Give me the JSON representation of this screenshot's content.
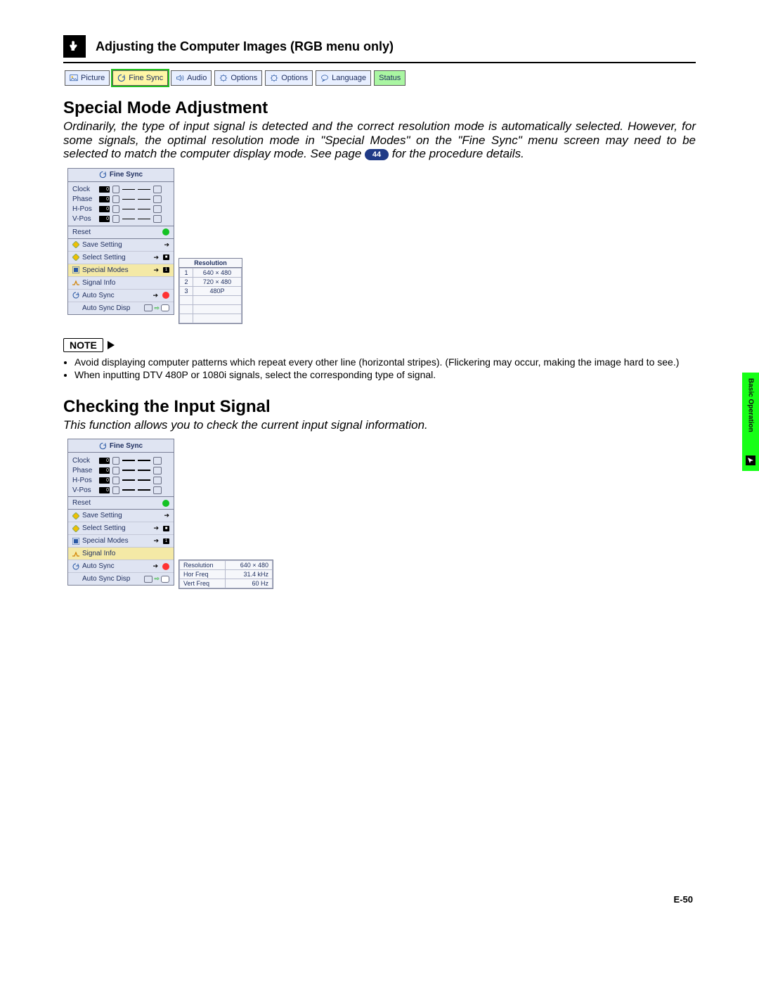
{
  "header": {
    "title": "Adjusting the Computer Images (RGB menu only)"
  },
  "tabs": [
    {
      "label": "Picture",
      "icon": "picture-icon",
      "sel": false
    },
    {
      "label": "Fine Sync",
      "icon": "sync-icon",
      "sel": true
    },
    {
      "label": "Audio",
      "icon": "audio-icon",
      "sel": false
    },
    {
      "label": "Options",
      "icon": "options-icon",
      "sel": false
    },
    {
      "label": "Options",
      "icon": "options-icon",
      "sel": false
    },
    {
      "label": "Language",
      "icon": "language-icon",
      "sel": false
    },
    {
      "label": "Status",
      "icon": "status-icon",
      "sel": false
    }
  ],
  "section1": {
    "heading": "Special Mode Adjustment",
    "para_a": "Ordinarily, the type of input signal is detected and the correct resolution mode is automatically selected. However, for some signals, the optimal resolution mode in \"Special Modes\" on the \"Fine Sync\" menu screen may need to be selected to match the computer display mode. See page ",
    "pageref": "44",
    "para_b": " for the procedure details."
  },
  "fine_sync_menu": {
    "title": "Fine Sync",
    "sliders": [
      {
        "label": "Clock",
        "value": "0"
      },
      {
        "label": "Phase",
        "value": "0"
      },
      {
        "label": "H-Pos",
        "value": "0"
      },
      {
        "label": "V-Pos",
        "value": "0"
      }
    ],
    "reset": "Reset",
    "items": [
      {
        "label": "Save Setting",
        "icon": "diamond"
      },
      {
        "label": "Select Setting",
        "icon": "diamond"
      },
      {
        "label": "Special Modes",
        "icon": "modes"
      },
      {
        "label": "Signal Info",
        "icon": "info"
      },
      {
        "label": "Auto Sync",
        "icon": "sync"
      },
      {
        "label": "Auto Sync Disp",
        "icon": "none"
      }
    ],
    "highlight_a_index": 2,
    "highlight_b_index": 3
  },
  "resolution_popup": {
    "header": "Resolution",
    "rows": [
      {
        "n": "1",
        "v": "640 × 480"
      },
      {
        "n": "2",
        "v": "720 × 480"
      },
      {
        "n": "3",
        "v": "480P"
      }
    ],
    "blank_rows": 3
  },
  "note": {
    "label": "NOTE",
    "items": [
      "Avoid displaying computer patterns which repeat every other line (horizontal stripes). (Flickering may occur, making the image hard to see.)",
      "When inputting DTV 480P or 1080i signals, select the corresponding type of signal."
    ]
  },
  "section2": {
    "heading": "Checking the Input Signal",
    "para": "This function allows you to check the current input signal information."
  },
  "signal_info_popup": {
    "rows": [
      {
        "k": "Resolution",
        "v": "640 × 480"
      },
      {
        "k": "Hor Freq",
        "v": "31.4 kHz"
      },
      {
        "k": "Vert Freq",
        "v": "60  Hz"
      }
    ]
  },
  "side_tab": {
    "label": "Basic Operation"
  },
  "page_number": "E-50"
}
